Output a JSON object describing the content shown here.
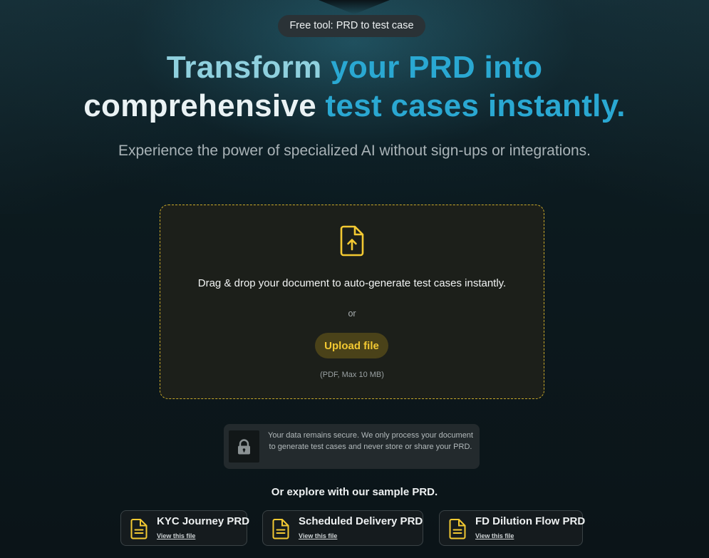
{
  "badge": "Free tool: PRD to test case",
  "hero": {
    "part1": "Transform ",
    "part2": "your PRD into",
    "part3": "comprehensive ",
    "part4": "test cases instantly."
  },
  "subtitle": "Experience the power of specialized AI without sign-ups or integrations.",
  "dropzone": {
    "title": "Drag & drop your document to auto-generate test cases instantly.",
    "or": "or",
    "upload_label": "Upload file",
    "hint": "(PDF, Max 10 MB)"
  },
  "security_note": "Your data remains secure. We only process your document to generate test cases and never store or share your PRD.",
  "explore_heading": "Or explore with our sample PRD.",
  "samples": [
    {
      "title": "KYC Journey PRD",
      "link": "View this file"
    },
    {
      "title": "Scheduled Delivery PRD",
      "link": "View this file"
    },
    {
      "title": "FD Dilution Flow PRD",
      "link": "View this file"
    }
  ],
  "colors": {
    "accent_yellow": "#f3c932",
    "hero_light": "#8fd0de",
    "hero_blue": "#2aa8d2"
  },
  "icons": [
    "file-upload-icon",
    "lock-icon",
    "document-icon"
  ]
}
